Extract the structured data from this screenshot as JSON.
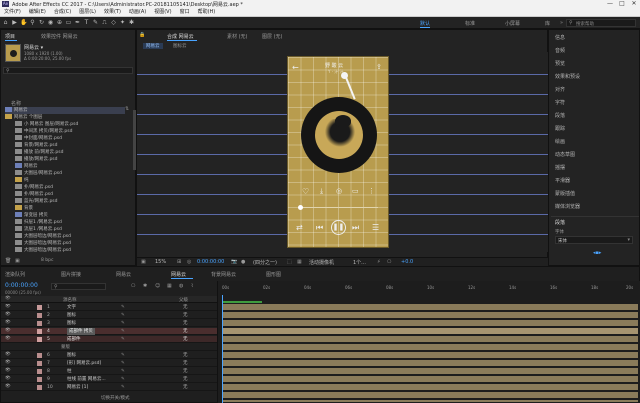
{
  "app": {
    "title": "Adobe After Effects CC 2017 - C:\\Users\\Administrator.PC-20181105141\\Desktop\\网易云.aep *",
    "window_controls": [
      "—",
      "□",
      "✕"
    ]
  },
  "menu": [
    "文件(F)",
    "编辑(E)",
    "合成(C)",
    "图层(L)",
    "效果(T)",
    "动画(A)",
    "视图(V)",
    "窗口",
    "帮助(H)"
  ],
  "toolbar": {
    "workspaces": [
      "默认",
      "标准",
      "小屏幕",
      "库"
    ],
    "active_ws": "默认",
    "search_placeholder": "搜索帮助"
  },
  "project": {
    "tabs": [
      "项目",
      "效果控件 网易云"
    ],
    "comp_name": "网易云 ▾",
    "comp_info": [
      "1080 x 1920 (1.00)",
      "Δ 0:00:20:00, 25.00 fps"
    ],
    "search_label": "名称",
    "items": [
      "网易云",
      "网易云 个图层",
      "小 网易云 图层/网易云.psd",
      "中间黑 拷贝/网易云.psd",
      "中封面/网易云.psd",
      "背景/网易云.psd",
      "播放 前/网易云.psd",
      "播放/网易云.psd",
      "网易云",
      "大图层/网易云.psd",
      "纯",
      "扑/网易云.psd",
      "扑/网易云.psd",
      "蓝光/网易云.psd",
      "背景",
      "渐变层 拷贝",
      "扫层1 /网易云.psd",
      "流层1 /网易云.psd",
      "大图层暗边/网易云.psd",
      "大图层暗边/网易云.psd",
      "大图层暗边/网易云.psd"
    ],
    "bpc": "8 bpc"
  },
  "comp": {
    "tabs": [
      "合成 网易云",
      "素材 (无)",
      "图层 (无)"
    ],
    "breadcrumbs": [
      "网易云",
      "图标云"
    ],
    "zoom": "15%",
    "time": "0:00:00:00",
    "res": "(四分之一)",
    "view": "活动摄像机",
    "views": "1个...",
    "offset": "+0.0"
  },
  "phone": {
    "title": "野 酸 云",
    "subtitle": "Y · 汁 汁"
  },
  "right": {
    "items": [
      "信息",
      "音频",
      "预览",
      "效果和预设",
      "对齐",
      "字符",
      "段落",
      "跟踪",
      "绘画",
      "动态草图",
      "摇摆",
      "平滑器",
      "蒙版插值",
      "媒体浏览器"
    ],
    "section": "段落",
    "font_label": "字体",
    "font_value": "宋体"
  },
  "timeline": {
    "tabs": [
      "渲染队列",
      "图片拼接",
      "网易云",
      "网易云",
      "背景网易云",
      "图形图"
    ],
    "timecode": "0:00:00:00",
    "fps": "00000 (25.00 fps)",
    "columns": [
      "源名称",
      "父级"
    ],
    "ruler": [
      "00s",
      "02s",
      "04s",
      "06s",
      "08s",
      "10s",
      "12s",
      "14s",
      "16s",
      "18s",
      "20s"
    ],
    "bottom": "切换开关/模式",
    "layers": [
      {
        "n": "1",
        "name": "文字",
        "parent": "无"
      },
      {
        "n": "2",
        "name": "图标",
        "parent": "无"
      },
      {
        "n": "3",
        "name": "图标",
        "parent": "无"
      },
      {
        "n": "4",
        "name": "成部件 拷贝",
        "parent": "无"
      },
      {
        "n": "5",
        "name": "成部件",
        "parent": "无"
      },
      {
        "n": "",
        "name": "蒙版",
        "parent": ""
      },
      {
        "n": "6",
        "name": "图标",
        "parent": "无"
      },
      {
        "n": "7",
        "name": "[形] 网易云.psd]",
        "parent": "无"
      },
      {
        "n": "8",
        "name": "柱",
        "parent": "无"
      },
      {
        "n": "9",
        "name": "柱线 前置 网易云...",
        "parent": "无"
      },
      {
        "n": "10",
        "name": "网易云 [1]",
        "parent": "无"
      }
    ]
  },
  "colors": {
    "accent": "#4aa4ff",
    "gold": "#b89c4e",
    "dark": "#1f1f1f",
    "layer_selected": "#8a3b3b"
  }
}
